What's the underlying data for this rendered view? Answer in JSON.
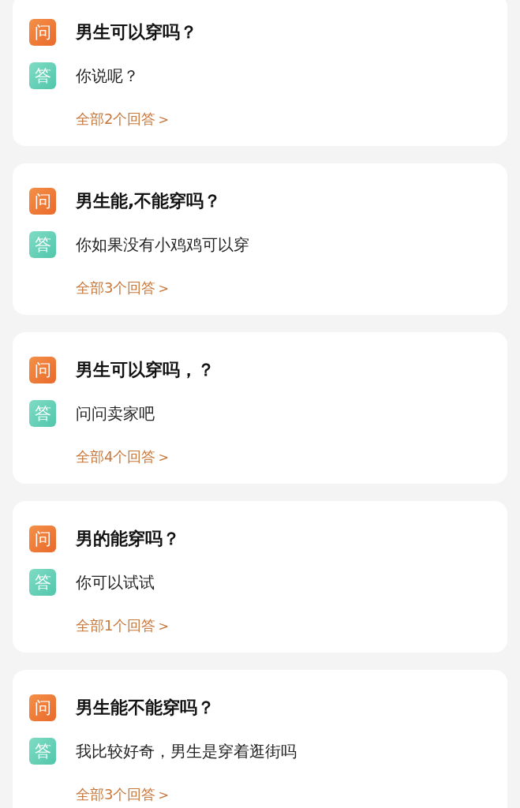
{
  "questions": [
    {
      "q_badge": "问",
      "question": "男生可以穿吗？",
      "a_badge": "答",
      "answer": "你说呢？",
      "link": "全部2个回答",
      "chevron": ">"
    },
    {
      "q_badge": "问",
      "question": "男生能,不能穿吗？",
      "a_badge": "答",
      "answer": "你如果没有小鸡鸡可以穿",
      "link": "全部3个回答",
      "chevron": ">"
    },
    {
      "q_badge": "问",
      "question": "男生可以穿吗，？",
      "a_badge": "答",
      "answer": "问问卖家吧",
      "link": "全部4个回答",
      "chevron": ">"
    },
    {
      "q_badge": "问",
      "question": "男的能穿吗？",
      "a_badge": "答",
      "answer": "你可以试试",
      "link": "全部1个回答",
      "chevron": ">"
    },
    {
      "q_badge": "问",
      "question": "男生能不能穿吗？",
      "a_badge": "答",
      "answer": "我比较好奇，男生是穿着逛街吗",
      "link": "全部3个回答",
      "chevron": ">"
    }
  ]
}
